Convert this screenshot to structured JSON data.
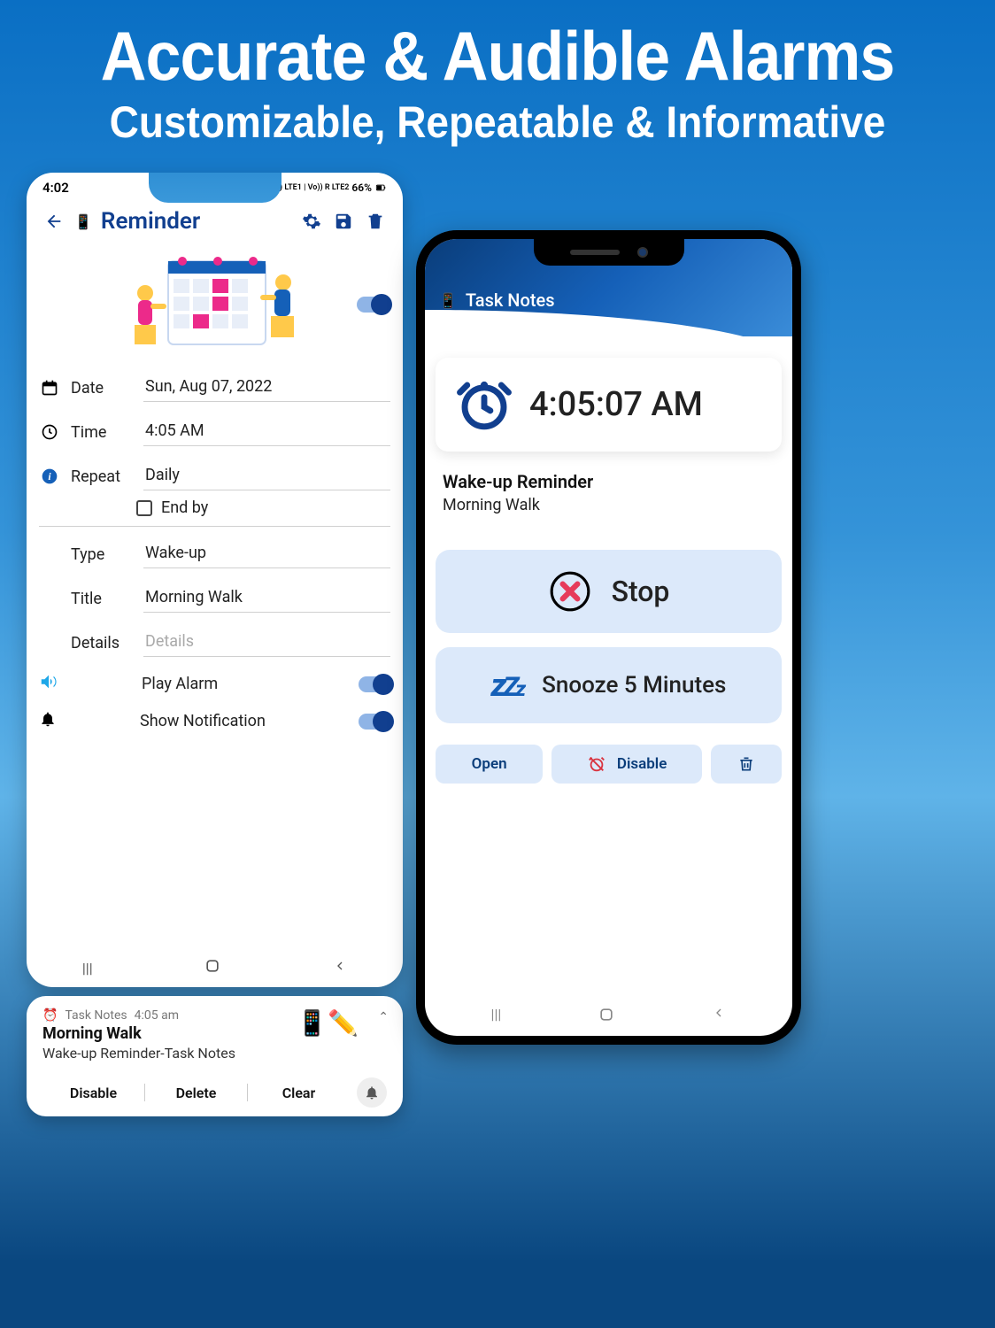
{
  "headline": {
    "line1": "Accurate & Audible Alarms",
    "line2": "Customizable, Repeatable & Informative"
  },
  "phone_left": {
    "status": {
      "time": "4:02",
      "signal": "Vo)) LTE1 | Vo)) R LTE2",
      "battery": "66%"
    },
    "appbar": {
      "title": "Reminder"
    },
    "form": {
      "date_label": "Date",
      "date_value": "Sun, Aug 07, 2022",
      "time_label": "Time",
      "time_value": "4:05 AM",
      "repeat_label": "Repeat",
      "repeat_value": "Daily",
      "end_by_label": "End by",
      "type_label": "Type",
      "type_value": "Wake-up",
      "title_label": "Title",
      "title_value": "Morning Walk",
      "details_label": "Details",
      "details_placeholder": "Details",
      "play_alarm_label": "Play Alarm",
      "show_notif_label": "Show Notification"
    }
  },
  "notification": {
    "app": "Task Notes",
    "time": "4:05 am",
    "title": "Morning Walk",
    "subtitle": "Wake-up  Reminder-Task Notes",
    "actions": {
      "disable": "Disable",
      "delete": "Delete",
      "clear": "Clear"
    }
  },
  "phone_right": {
    "header_title": "Task Notes",
    "alarm_time": "4:05:07 AM",
    "reminder_title": "Wake-up Reminder",
    "reminder_sub": "Morning Walk",
    "stop_label": "Stop",
    "snooze_label": "Snooze 5 Minutes",
    "open_label": "Open",
    "disable_label": "Disable"
  }
}
